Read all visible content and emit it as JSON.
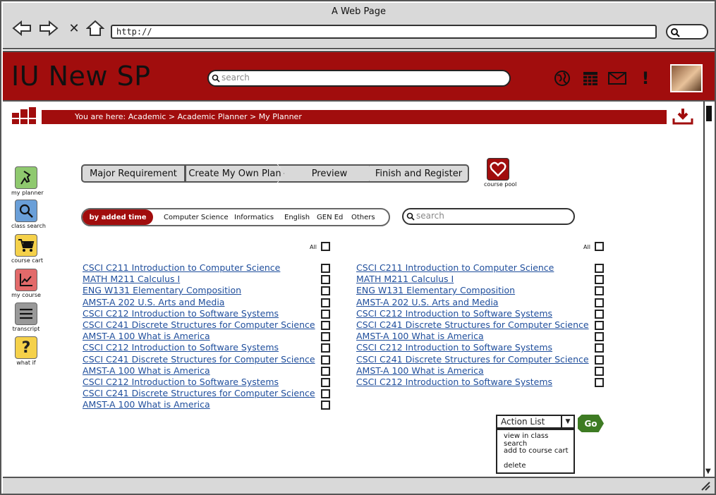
{
  "browser": {
    "window_title": "A Web Page",
    "url": "http://"
  },
  "header": {
    "brand": "IU New SP",
    "search_placeholder": "search",
    "accent_color": "#a10d0d"
  },
  "breadcrumb": "You are here: Academic > Academic Planner > My Planner",
  "sidebar": {
    "items": [
      {
        "label": "my planner",
        "color": "#8fc96f",
        "icon": "pin-icon"
      },
      {
        "label": "class search",
        "color": "#6a9fd8",
        "icon": "magnifier-icon"
      },
      {
        "label": "course cart",
        "color": "#f5d14a",
        "icon": "cart-icon"
      },
      {
        "label": "my course",
        "color": "#e26a6a",
        "icon": "chart-icon"
      },
      {
        "label": "transcript",
        "color": "#999999",
        "icon": "lines-icon"
      },
      {
        "label": "what if",
        "color": "#f5d14a",
        "icon": "question-icon"
      }
    ]
  },
  "wizard": {
    "steps": [
      "Major Requirement",
      "Create My Own Plan",
      "Preview",
      "Finish and Register"
    ]
  },
  "course_pool": {
    "label": "course pool"
  },
  "filter": {
    "active": "by added time",
    "options": [
      "Computer Science",
      "Informatics",
      "English",
      "GEN Ed",
      "Others"
    ]
  },
  "course_search_placeholder": "search",
  "all_label": "All",
  "left_courses": [
    "CSCI C211 Introduction to Computer Science",
    "MATH M211 Calculus I",
    "ENG W131 Elementary Composition",
    "AMST-A 202 U.S. Arts and Media",
    "CSCI C212 Introduction to Software Systems",
    "CSCI C241 Discrete Structures for Computer Science",
    "AMST-A 100 What is America",
    "CSCI C212 Introduction to Software Systems",
    "CSCI C241 Discrete Structures for Computer Science",
    "AMST-A 100 What is America",
    "CSCI C212 Introduction to Software Systems",
    "CSCI C241 Discrete Structures for Computer Science",
    "AMST-A 100 What is America"
  ],
  "right_courses": [
    "CSCI C211 Introduction to Computer Science",
    "MATH M211 Calculus I",
    "ENG W131 Elementary Composition",
    "AMST-A 202 U.S. Arts and Media",
    "CSCI C212 Introduction to Software Systems",
    "CSCI C241 Discrete Structures for Computer Science",
    "AMST-A 100 What is America",
    "CSCI C212 Introduction to Software Systems",
    "CSCI C241 Discrete Structures for Computer Science",
    "AMST-A 100 What is America",
    "CSCI C212 Introduction to Software Systems"
  ],
  "action_list": {
    "label": "Action List",
    "items": [
      "view in class search",
      "add to course cart",
      "delete"
    ],
    "go_label": "Go"
  }
}
